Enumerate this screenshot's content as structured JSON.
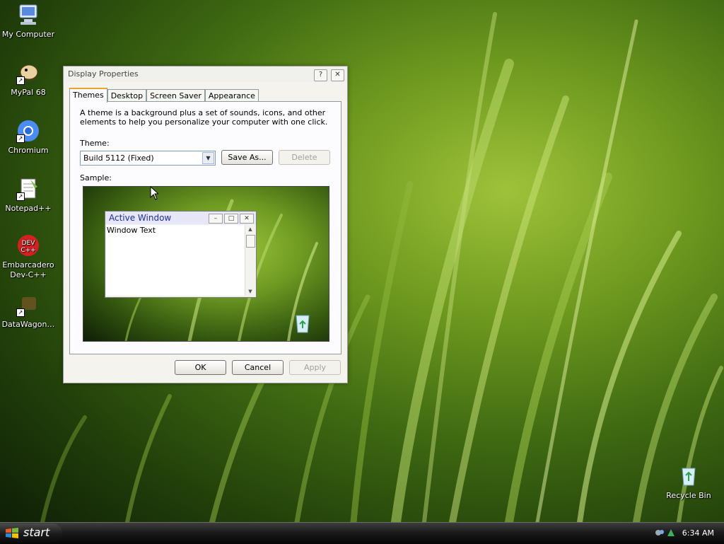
{
  "desktop": {
    "icons": [
      {
        "label": "My Computer",
        "icon": "my-computer-icon"
      },
      {
        "label": "MyPal 68",
        "icon": "mypal-icon"
      },
      {
        "label": "Chromium",
        "icon": "chromium-icon"
      },
      {
        "label": "Notepad++",
        "icon": "notepadpp-icon"
      },
      {
        "label": "Embarcadero Dev-C++",
        "icon": "devcpp-icon"
      },
      {
        "label": "DataWagon…",
        "icon": "datawagon-icon"
      }
    ],
    "recycle_bin": {
      "label": "Recycle Bin",
      "icon": "recycle-bin-icon"
    }
  },
  "dialog": {
    "title": "Display Properties",
    "help_glyph": "?",
    "close_glyph": "✕",
    "tabs": [
      {
        "label": "Themes",
        "active": true
      },
      {
        "label": "Desktop",
        "active": false
      },
      {
        "label": "Screen Saver",
        "active": false
      },
      {
        "label": "Appearance",
        "active": false
      }
    ],
    "description": "A theme is a background plus a set of sounds, icons, and other elements to help you personalize your computer with one click.",
    "theme_label": "Theme:",
    "theme_value": "Build 5112 (Fixed)",
    "save_as_label": "Save As...",
    "delete_label": "Delete",
    "sample_label": "Sample:",
    "sample_window": {
      "title": "Active Window",
      "text": "Window Text"
    },
    "ok_label": "OK",
    "cancel_label": "Cancel",
    "apply_label": "Apply"
  },
  "taskbar": {
    "start_label": "start",
    "clock": "6:34 AM"
  },
  "colors": {
    "accent_tab": "#e8a42c",
    "active_title_text": "#1a2f9a",
    "taskbar": "#1b1b1b"
  }
}
